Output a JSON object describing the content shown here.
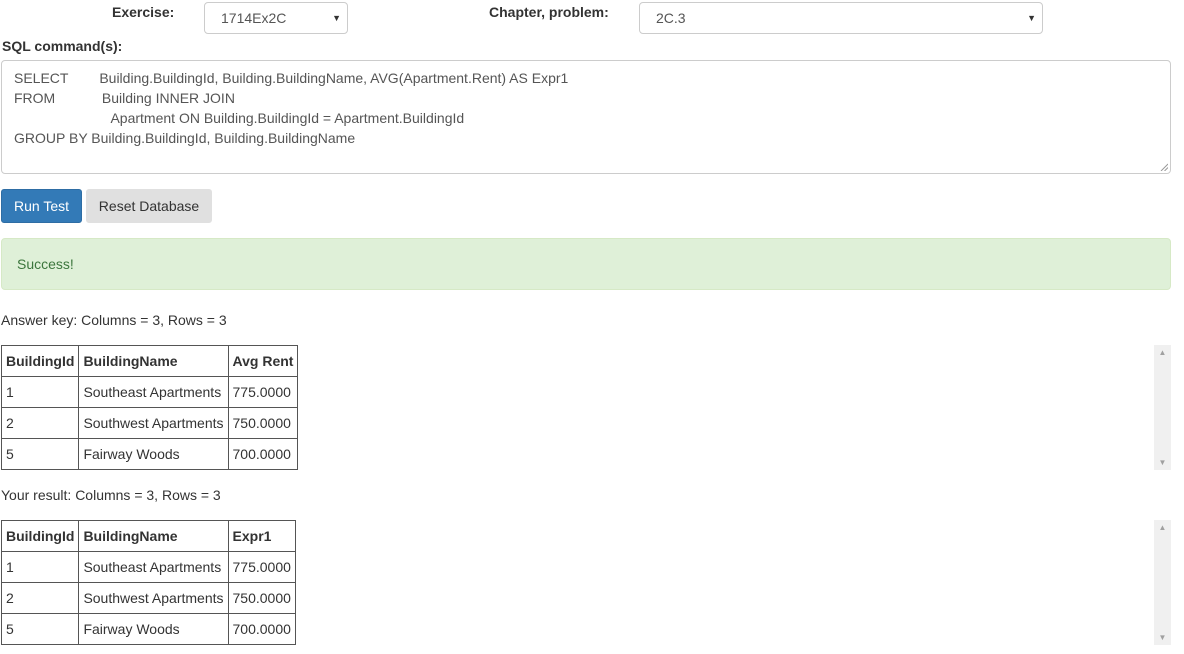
{
  "exercise": {
    "label": "Exercise:",
    "value": "1714Ex2C"
  },
  "chapter": {
    "label": "Chapter, problem:",
    "value": "2C.3"
  },
  "sql": {
    "label": "SQL command(s):",
    "lines": [
      "SELECT        Building.BuildingId, Building.BuildingName, AVG(Apartment.Rent) AS Expr1",
      "FROM            Building INNER JOIN",
      "                         Apartment ON Building.BuildingId = Apartment.BuildingId",
      "GROUP BY Building.BuildingId, Building.BuildingName"
    ]
  },
  "buttons": {
    "run_test": "Run Test",
    "reset_database": "Reset Database"
  },
  "alert": {
    "message": "Success!"
  },
  "answer_key": {
    "caption": "Answer key: Columns = 3, Rows = 3",
    "headers": [
      "BuildingId",
      "BuildingName",
      "Avg Rent"
    ],
    "rows": [
      [
        "1",
        "Southeast Apartments",
        "775.0000"
      ],
      [
        "2",
        "Southwest Apartments",
        "750.0000"
      ],
      [
        "5",
        "Fairway Woods",
        "700.0000"
      ]
    ]
  },
  "your_result": {
    "caption": "Your result: Columns = 3, Rows = 3",
    "headers": [
      "BuildingId",
      "BuildingName",
      "Expr1"
    ],
    "rows": [
      [
        "1",
        "Southeast Apartments",
        "775.0000"
      ],
      [
        "2",
        "Southwest Apartments",
        "750.0000"
      ],
      [
        "5",
        "Fairway Woods",
        "700.0000"
      ]
    ]
  },
  "icons": {
    "dropdown": "chevron-down-icon",
    "scroll_up": "arrow-up-icon",
    "scroll_down": "arrow-down-icon"
  },
  "colors": {
    "primary": "#337ab7",
    "success_bg": "#dff0d8",
    "success_text": "#3c763d"
  }
}
